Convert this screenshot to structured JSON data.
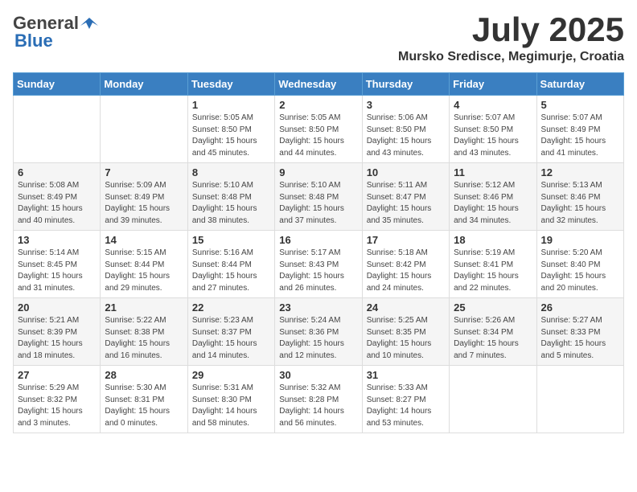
{
  "header": {
    "logo_general": "General",
    "logo_blue": "Blue",
    "title": "July 2025",
    "location": "Mursko Sredisce, Megimurje, Croatia"
  },
  "weekdays": [
    "Sunday",
    "Monday",
    "Tuesday",
    "Wednesday",
    "Thursday",
    "Friday",
    "Saturday"
  ],
  "weeks": [
    [
      {
        "day": "",
        "sunrise": "",
        "sunset": "",
        "daylight": ""
      },
      {
        "day": "",
        "sunrise": "",
        "sunset": "",
        "daylight": ""
      },
      {
        "day": "1",
        "sunrise": "Sunrise: 5:05 AM",
        "sunset": "Sunset: 8:50 PM",
        "daylight": "Daylight: 15 hours and 45 minutes."
      },
      {
        "day": "2",
        "sunrise": "Sunrise: 5:05 AM",
        "sunset": "Sunset: 8:50 PM",
        "daylight": "Daylight: 15 hours and 44 minutes."
      },
      {
        "day": "3",
        "sunrise": "Sunrise: 5:06 AM",
        "sunset": "Sunset: 8:50 PM",
        "daylight": "Daylight: 15 hours and 43 minutes."
      },
      {
        "day": "4",
        "sunrise": "Sunrise: 5:07 AM",
        "sunset": "Sunset: 8:50 PM",
        "daylight": "Daylight: 15 hours and 43 minutes."
      },
      {
        "day": "5",
        "sunrise": "Sunrise: 5:07 AM",
        "sunset": "Sunset: 8:49 PM",
        "daylight": "Daylight: 15 hours and 41 minutes."
      }
    ],
    [
      {
        "day": "6",
        "sunrise": "Sunrise: 5:08 AM",
        "sunset": "Sunset: 8:49 PM",
        "daylight": "Daylight: 15 hours and 40 minutes."
      },
      {
        "day": "7",
        "sunrise": "Sunrise: 5:09 AM",
        "sunset": "Sunset: 8:49 PM",
        "daylight": "Daylight: 15 hours and 39 minutes."
      },
      {
        "day": "8",
        "sunrise": "Sunrise: 5:10 AM",
        "sunset": "Sunset: 8:48 PM",
        "daylight": "Daylight: 15 hours and 38 minutes."
      },
      {
        "day": "9",
        "sunrise": "Sunrise: 5:10 AM",
        "sunset": "Sunset: 8:48 PM",
        "daylight": "Daylight: 15 hours and 37 minutes."
      },
      {
        "day": "10",
        "sunrise": "Sunrise: 5:11 AM",
        "sunset": "Sunset: 8:47 PM",
        "daylight": "Daylight: 15 hours and 35 minutes."
      },
      {
        "day": "11",
        "sunrise": "Sunrise: 5:12 AM",
        "sunset": "Sunset: 8:46 PM",
        "daylight": "Daylight: 15 hours and 34 minutes."
      },
      {
        "day": "12",
        "sunrise": "Sunrise: 5:13 AM",
        "sunset": "Sunset: 8:46 PM",
        "daylight": "Daylight: 15 hours and 32 minutes."
      }
    ],
    [
      {
        "day": "13",
        "sunrise": "Sunrise: 5:14 AM",
        "sunset": "Sunset: 8:45 PM",
        "daylight": "Daylight: 15 hours and 31 minutes."
      },
      {
        "day": "14",
        "sunrise": "Sunrise: 5:15 AM",
        "sunset": "Sunset: 8:44 PM",
        "daylight": "Daylight: 15 hours and 29 minutes."
      },
      {
        "day": "15",
        "sunrise": "Sunrise: 5:16 AM",
        "sunset": "Sunset: 8:44 PM",
        "daylight": "Daylight: 15 hours and 27 minutes."
      },
      {
        "day": "16",
        "sunrise": "Sunrise: 5:17 AM",
        "sunset": "Sunset: 8:43 PM",
        "daylight": "Daylight: 15 hours and 26 minutes."
      },
      {
        "day": "17",
        "sunrise": "Sunrise: 5:18 AM",
        "sunset": "Sunset: 8:42 PM",
        "daylight": "Daylight: 15 hours and 24 minutes."
      },
      {
        "day": "18",
        "sunrise": "Sunrise: 5:19 AM",
        "sunset": "Sunset: 8:41 PM",
        "daylight": "Daylight: 15 hours and 22 minutes."
      },
      {
        "day": "19",
        "sunrise": "Sunrise: 5:20 AM",
        "sunset": "Sunset: 8:40 PM",
        "daylight": "Daylight: 15 hours and 20 minutes."
      }
    ],
    [
      {
        "day": "20",
        "sunrise": "Sunrise: 5:21 AM",
        "sunset": "Sunset: 8:39 PM",
        "daylight": "Daylight: 15 hours and 18 minutes."
      },
      {
        "day": "21",
        "sunrise": "Sunrise: 5:22 AM",
        "sunset": "Sunset: 8:38 PM",
        "daylight": "Daylight: 15 hours and 16 minutes."
      },
      {
        "day": "22",
        "sunrise": "Sunrise: 5:23 AM",
        "sunset": "Sunset: 8:37 PM",
        "daylight": "Daylight: 15 hours and 14 minutes."
      },
      {
        "day": "23",
        "sunrise": "Sunrise: 5:24 AM",
        "sunset": "Sunset: 8:36 PM",
        "daylight": "Daylight: 15 hours and 12 minutes."
      },
      {
        "day": "24",
        "sunrise": "Sunrise: 5:25 AM",
        "sunset": "Sunset: 8:35 PM",
        "daylight": "Daylight: 15 hours and 10 minutes."
      },
      {
        "day": "25",
        "sunrise": "Sunrise: 5:26 AM",
        "sunset": "Sunset: 8:34 PM",
        "daylight": "Daylight: 15 hours and 7 minutes."
      },
      {
        "day": "26",
        "sunrise": "Sunrise: 5:27 AM",
        "sunset": "Sunset: 8:33 PM",
        "daylight": "Daylight: 15 hours and 5 minutes."
      }
    ],
    [
      {
        "day": "27",
        "sunrise": "Sunrise: 5:29 AM",
        "sunset": "Sunset: 8:32 PM",
        "daylight": "Daylight: 15 hours and 3 minutes."
      },
      {
        "day": "28",
        "sunrise": "Sunrise: 5:30 AM",
        "sunset": "Sunset: 8:31 PM",
        "daylight": "Daylight: 15 hours and 0 minutes."
      },
      {
        "day": "29",
        "sunrise": "Sunrise: 5:31 AM",
        "sunset": "Sunset: 8:30 PM",
        "daylight": "Daylight: 14 hours and 58 minutes."
      },
      {
        "day": "30",
        "sunrise": "Sunrise: 5:32 AM",
        "sunset": "Sunset: 8:28 PM",
        "daylight": "Daylight: 14 hours and 56 minutes."
      },
      {
        "day": "31",
        "sunrise": "Sunrise: 5:33 AM",
        "sunset": "Sunset: 8:27 PM",
        "daylight": "Daylight: 14 hours and 53 minutes."
      },
      {
        "day": "",
        "sunrise": "",
        "sunset": "",
        "daylight": ""
      },
      {
        "day": "",
        "sunrise": "",
        "sunset": "",
        "daylight": ""
      }
    ]
  ]
}
